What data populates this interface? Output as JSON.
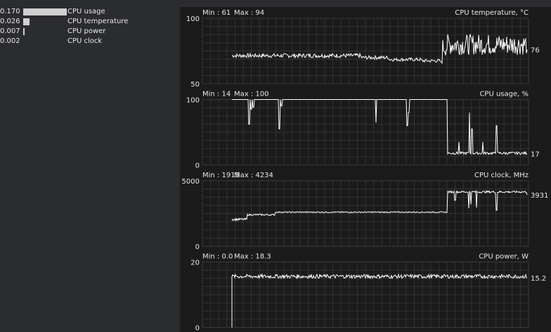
{
  "sources": [
    {
      "value": "0.170",
      "level": 1.0,
      "label": "CPU usage"
    },
    {
      "value": "0.026",
      "level": 0.15,
      "label": "CPU temperature"
    },
    {
      "value": "0.007",
      "level": 0.04,
      "label": "CPU power"
    },
    {
      "value": "0.002",
      "level": 0.0,
      "label": "CPU clock"
    }
  ],
  "colors": {
    "background": "#2b2c30",
    "graph_bg": "#1b1b1b",
    "grid": "#333333",
    "line": "#ffffff",
    "bar": "#d0d0d0"
  },
  "graphs": [
    {
      "title": "CPU temperature, °C",
      "min_label": "Min : 61",
      "max_label": "Max : 94",
      "y_top": "100",
      "y_bottom": "50",
      "current": "76",
      "ymin": 50,
      "ymax": 100,
      "segments": [
        {
          "from": 0.0,
          "to": 0.6,
          "level": 71.5,
          "noise": 1.6
        },
        {
          "from": 0.6,
          "to": 0.73,
          "level": 70.0,
          "noise": 1.4
        },
        {
          "from": 0.73,
          "to": 0.88,
          "level": 68.5,
          "noise": 1.3
        },
        {
          "from": 0.88,
          "to": 0.97,
          "level": 67.5,
          "noise": 1.3
        },
        {
          "from": 0.97,
          "to": 0.98,
          "level": 66.5,
          "noise": 1.0
        },
        {
          "from": 0.98,
          "to": 1.0,
          "level": 78.0,
          "noise": 7.0
        }
      ],
      "spikes": [],
      "rel_start": 0.0,
      "after_end": 80,
      "after_noise": 8,
      "end_val": 76
    },
    {
      "title": "CPU usage, %",
      "min_label": "Min : 14",
      "max_label": "Max : 100",
      "y_top": "100",
      "y_bottom": "0",
      "current": "17",
      "ymin": 0,
      "ymax": 100,
      "segments": [
        {
          "from": 0.0,
          "to": 1.0,
          "level": 100,
          "noise": 0
        }
      ],
      "spikes": [
        {
          "t": 0.08,
          "v": 62
        },
        {
          "t": 0.09,
          "v": 85
        },
        {
          "t": 0.1,
          "v": 88
        },
        {
          "t": 0.22,
          "v": 55
        },
        {
          "t": 0.23,
          "v": 90
        },
        {
          "t": 0.67,
          "v": 65
        },
        {
          "t": 0.815,
          "v": 60
        },
        {
          "t": 0.822,
          "v": 80
        }
      ],
      "rel_start": 0.0,
      "after_end": 18,
      "after_noise": 2,
      "end_val": 17,
      "after_spikes": [
        {
          "t": 0.15,
          "v": 35
        },
        {
          "t": 0.28,
          "v": 80
        },
        {
          "t": 0.31,
          "v": 55
        },
        {
          "t": 0.45,
          "v": 35
        },
        {
          "t": 0.62,
          "v": 60
        }
      ]
    },
    {
      "title": "CPU clock, MHz",
      "min_label": "Min : 1915",
      "max_label": "Max : 4234",
      "y_top": "5000",
      "y_bottom": "0",
      "current": "3931",
      "ymin": 0,
      "ymax": 5000,
      "segments": [
        {
          "from": 0.0,
          "to": 0.07,
          "level": 2050,
          "noise": 90
        },
        {
          "from": 0.07,
          "to": 0.2,
          "level": 2400,
          "noise": 60
        },
        {
          "from": 0.2,
          "to": 1.0,
          "level": 2600,
          "noise": 40
        }
      ],
      "spikes": [],
      "rel_start": 0.0,
      "after_end": 4150,
      "after_noise": 80,
      "end_val": 3931,
      "after_spikes": [
        {
          "t": 0.1,
          "v": 3500
        },
        {
          "t": 0.27,
          "v": 2900
        },
        {
          "t": 0.3,
          "v": 3200
        },
        {
          "t": 0.37,
          "v": 2950
        },
        {
          "t": 0.62,
          "v": 2750
        }
      ]
    },
    {
      "title": "CPU power, W",
      "min_label": "Min : 0.0",
      "max_label": "Max : 18.3",
      "y_top": "20",
      "y_bottom": "0",
      "current": "15.2",
      "ymin": 0,
      "ymax": 20,
      "segments": [
        {
          "from": 0.0,
          "to": 1.0,
          "level": 15.6,
          "noise": 0.6
        }
      ],
      "spikes": [],
      "rel_start": 0.0,
      "after_end": 15.6,
      "after_noise": 0.6,
      "end_val": 15.2,
      "start_zero": true
    }
  ]
}
